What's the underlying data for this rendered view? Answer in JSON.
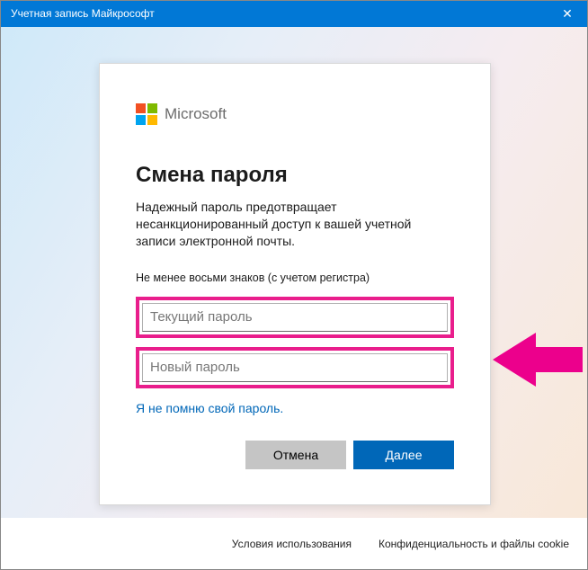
{
  "window": {
    "title": "Учетная запись Майкрософт"
  },
  "brand": {
    "wordmark": "Microsoft"
  },
  "panel": {
    "heading": "Смена пароля",
    "description": "Надежный пароль предотвращает несанкционированный доступ к вашей учетной записи электронной почты.",
    "rule": "Не менее восьми знаков (с учетом регистра)",
    "current_placeholder": "Текущий пароль",
    "new_placeholder": "Новый пароль",
    "forgot": "Я не помню свой пароль.",
    "cancel": "Отмена",
    "next": "Далее"
  },
  "footer": {
    "terms": "Условия использования",
    "privacy": "Конфиденциальность и файлы cookie"
  },
  "colors": {
    "accent": "#0178d6",
    "primary_button": "#0067b8",
    "highlight_box": "#e91e8c",
    "arrow": "#ec008c"
  }
}
